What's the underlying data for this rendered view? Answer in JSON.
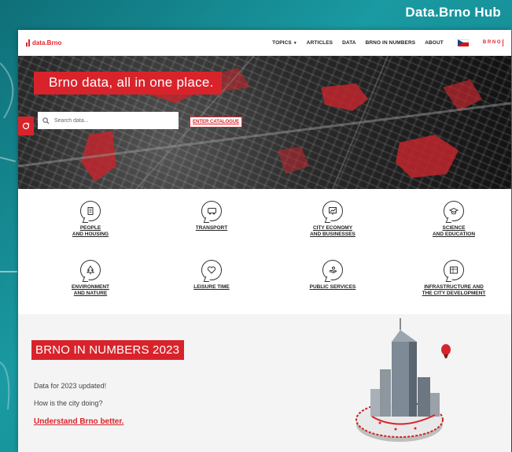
{
  "hub_title": "Data.Brno Hub",
  "brand": {
    "logo_text": "data.Brno"
  },
  "nav": {
    "items": [
      "TOPICS",
      "ARTICLES",
      "DATA",
      "BRNO IN NUMBERS",
      "ABOUT"
    ],
    "badge_text": "B R N O"
  },
  "hero": {
    "tagline": "Brno data, all in one place.",
    "search_placeholder": "Search data...",
    "enter_button": "ENTER CATALOGUE"
  },
  "topics": [
    {
      "line1": "PEOPLE",
      "line2": "AND HOUSING",
      "icon": "building-icon"
    },
    {
      "line1": "TRANSPORT",
      "line2": "",
      "icon": "bus-icon"
    },
    {
      "line1": "CITY ECONOMY",
      "line2": "AND BUSINESSES",
      "icon": "chart-board-icon"
    },
    {
      "line1": "SCIENCE",
      "line2": "AND EDUCATION",
      "icon": "graduation-cap-icon"
    },
    {
      "line1": "ENVIRONMENT",
      "line2": "AND NATURE",
      "icon": "tree-icon"
    },
    {
      "line1": "LEISURE TIME",
      "line2": "",
      "icon": "heart-icon"
    },
    {
      "line1": "PUBLIC SERVICES",
      "line2": "",
      "icon": "hand-icon"
    },
    {
      "line1": "INFRASTRUCTURE AND",
      "line2": "THE CITY DEVELOPMENT",
      "icon": "blueprint-icon"
    }
  ],
  "numbers": {
    "title": "BRNO IN NUMBERS 2023",
    "line1": "Data for 2023 updated!",
    "line2": "How is the city doing?",
    "link": "Understand Brno better."
  },
  "colors": {
    "accent": "#d9232b",
    "background": "#138a92"
  }
}
